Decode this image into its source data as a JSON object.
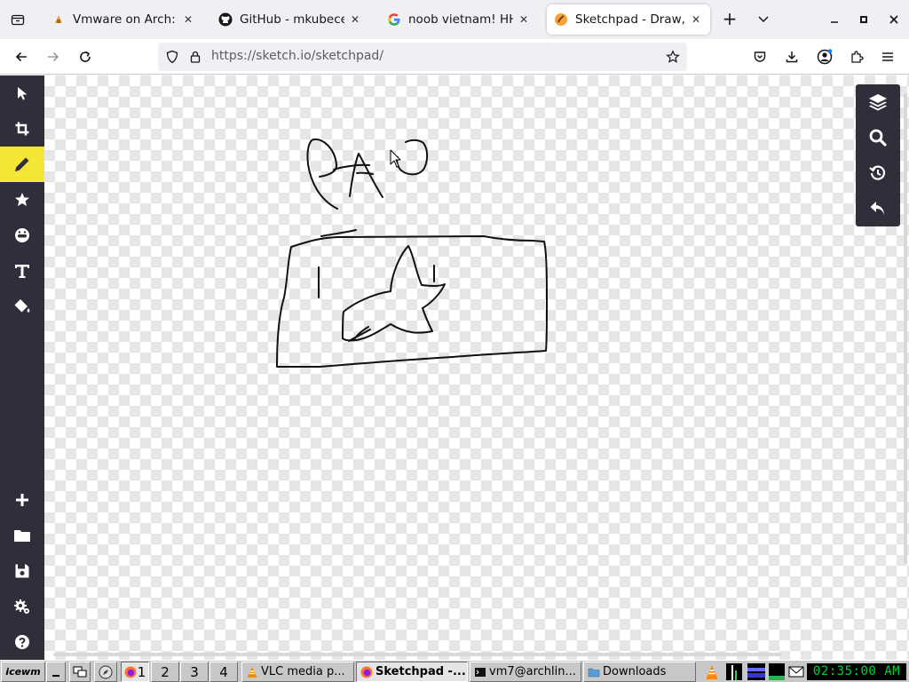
{
  "browser": {
    "tabs": [
      {
        "title": "Vmware on Arch: C",
        "icon": "vmware-favicon",
        "active": false
      },
      {
        "title": "GitHub - mkubecek",
        "icon": "github-favicon",
        "active": false
      },
      {
        "title": "noob vietnam! HHA",
        "icon": "google-favicon",
        "active": false
      },
      {
        "title": "Sketchpad - Draw, C",
        "icon": "sketchpad-favicon",
        "active": true
      }
    ],
    "close_glyph": "✕",
    "new_tab_glyph": "+",
    "url": "https://sketch.io/sketchpad/",
    "url_host": "sketch.io"
  },
  "sketchpad": {
    "left_tools": [
      {
        "name": "select",
        "icon": "cursor-arrow-icon"
      },
      {
        "name": "crop",
        "icon": "crop-icon"
      },
      {
        "name": "pencil",
        "icon": "pencil-icon",
        "active": true
      },
      {
        "name": "stamp",
        "icon": "star-icon"
      },
      {
        "name": "emoji",
        "icon": "emoji-icon"
      },
      {
        "name": "text",
        "icon": "text-icon"
      },
      {
        "name": "fill",
        "icon": "paint-bucket-icon"
      }
    ],
    "bottom_tools": [
      {
        "name": "new",
        "icon": "plus-icon"
      },
      {
        "name": "open",
        "icon": "folder-icon"
      },
      {
        "name": "save",
        "icon": "save-icon"
      },
      {
        "name": "settings",
        "icon": "gear-icon"
      },
      {
        "name": "help",
        "icon": "help-icon"
      }
    ],
    "right_tools": [
      {
        "name": "layers",
        "icon": "layers-icon"
      },
      {
        "name": "zoom",
        "icon": "search-icon"
      },
      {
        "name": "history",
        "icon": "history-icon"
      },
      {
        "name": "undo",
        "icon": "undo-icon"
      }
    ],
    "toolbar_bg": "#2f2f3b",
    "active_tool_color": "#f5e534"
  },
  "taskbar": {
    "start_label": "icewm",
    "workspaces": [
      "1",
      "2",
      "3",
      "4"
    ],
    "active_workspace": "1",
    "windows": [
      {
        "title": "VLC media p...",
        "icon": "vlc-icon",
        "active": false
      },
      {
        "title": "Sketchpad -...",
        "icon": "firefox-icon",
        "active": true
      },
      {
        "title": "vm7@archlin...",
        "icon": "terminal-icon",
        "active": false
      },
      {
        "title": "Downloads",
        "icon": "folder-icon",
        "active": false
      }
    ],
    "clock": "02:35:00 AM",
    "clock_color": "#00d23c"
  }
}
